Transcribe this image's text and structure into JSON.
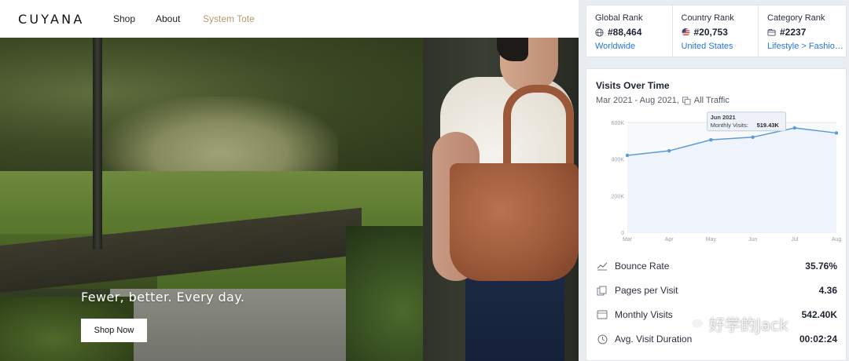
{
  "site": {
    "logo": "CUYANA",
    "nav": [
      {
        "label": "Shop"
      },
      {
        "label": "About"
      },
      {
        "label": "System Tote"
      }
    ],
    "accent_color": "#b69970"
  },
  "hero": {
    "tagline": "Fewer, better. Every day.",
    "cta": "Shop Now"
  },
  "ranks": {
    "global": {
      "title": "Global Rank",
      "value": "#88,464",
      "link": "Worldwide",
      "icon": "globe-icon"
    },
    "country": {
      "title": "Country Rank",
      "value": "#20,753",
      "link": "United States",
      "icon": "us-flag-icon"
    },
    "category": {
      "title": "Category Rank",
      "value": "#2237",
      "link": "Lifestyle > Fashion and Apparel",
      "icon": "category-icon"
    }
  },
  "visits": {
    "title": "Visits Over Time",
    "subtitle": "Mar 2021 - Aug 2021,",
    "traffic": "All Traffic"
  },
  "chart_data": {
    "type": "area",
    "categories": [
      "Mar",
      "Apr",
      "May",
      "Jun",
      "Jul",
      "Aug"
    ],
    "values": [
      420000,
      445000,
      505000,
      519430,
      570000,
      542400
    ],
    "yticks": [
      "0",
      "200K",
      "400K",
      "600K"
    ],
    "ylim": [
      0,
      600000
    ],
    "grid": true,
    "tooltip": {
      "title": "Jun 2021",
      "label": "Monthly Visits:",
      "value": "519.43K"
    },
    "line_color": "#5b9bd5",
    "fill_color": "#eef3fc"
  },
  "metrics": [
    {
      "label": "Bounce Rate",
      "value": "35.76%",
      "icon": "bounce-icon"
    },
    {
      "label": "Pages per Visit",
      "value": "4.36",
      "icon": "pages-icon"
    },
    {
      "label": "Monthly Visits",
      "value": "542.40K",
      "icon": "visits-icon"
    },
    {
      "label": "Avg. Visit Duration",
      "value": "00:02:24",
      "icon": "clock-icon"
    }
  ],
  "watermark": "好学的Jack"
}
